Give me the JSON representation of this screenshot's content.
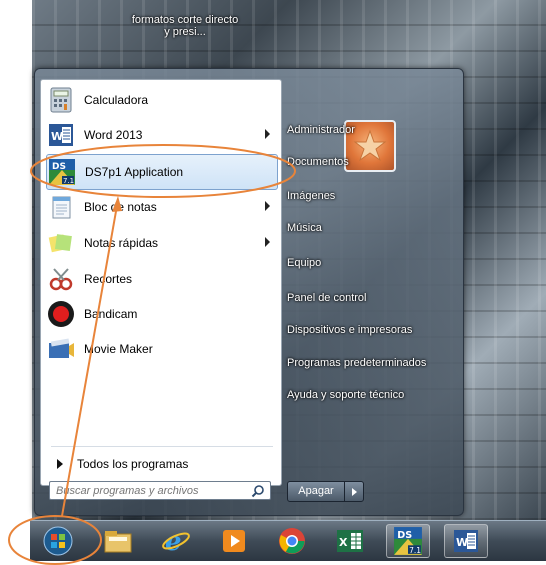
{
  "desktop": {
    "icon_label": "formatos corte directo y presi..."
  },
  "start_menu": {
    "programs": [
      {
        "label": "Calculadora",
        "icon": "calculator-icon",
        "has_submenu": false
      },
      {
        "label": "Word 2013",
        "icon": "word-icon",
        "has_submenu": true
      },
      {
        "label": "DS7p1 Application",
        "icon": "ds7p1-icon",
        "has_submenu": false,
        "selected": true
      },
      {
        "label": "Bloc de notas",
        "icon": "notepad-icon",
        "has_submenu": true
      },
      {
        "label": "Notas rápidas",
        "icon": "sticky-notes-icon",
        "has_submenu": true
      },
      {
        "label": "Recortes",
        "icon": "snipping-tool-icon",
        "has_submenu": false
      },
      {
        "label": "Bandicam",
        "icon": "bandicam-icon",
        "has_submenu": false
      },
      {
        "label": "Movie Maker",
        "icon": "movie-maker-icon",
        "has_submenu": false
      }
    ],
    "all_programs_label": "Todos los programas",
    "search_placeholder": "Buscar programas y archivos",
    "right_items": [
      "Administrador",
      "Documentos",
      "Imágenes",
      "Música",
      "Equipo",
      "Panel de control",
      "Dispositivos e impresoras",
      "Programas predeterminados",
      "Ayuda y soporte técnico"
    ],
    "shutdown_label": "Apagar"
  },
  "taskbar": {
    "items": [
      "start-orb-icon",
      "file-explorer-icon",
      "internet-explorer-icon",
      "media-player-icon",
      "chrome-icon",
      "excel-icon",
      "ds7p1-icon",
      "word-icon"
    ]
  },
  "colors": {
    "annotation": "#e8843a",
    "selection": "#cfe3f7"
  }
}
